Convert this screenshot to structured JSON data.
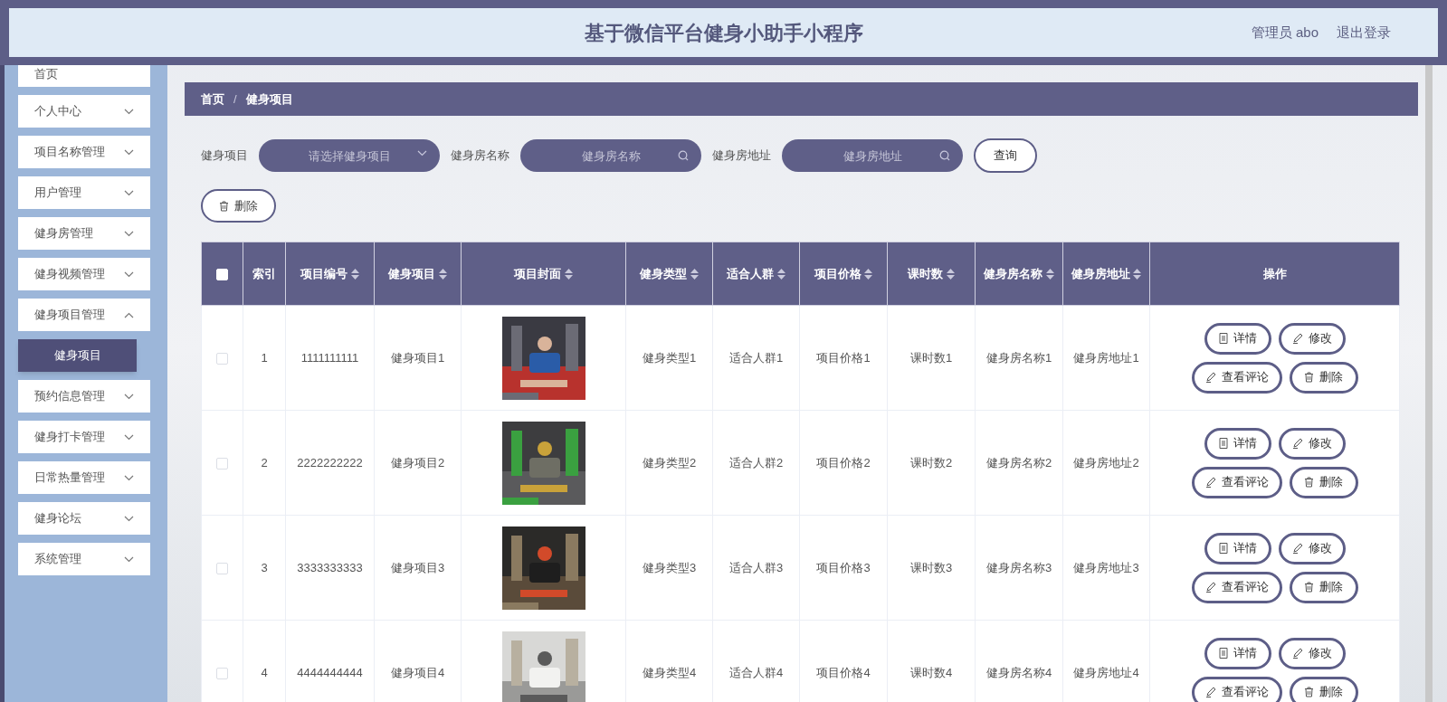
{
  "header": {
    "title": "基于微信平台健身小助手小程序",
    "user": "管理员 abo",
    "logout": "退出登录"
  },
  "sidebar": {
    "items": [
      {
        "label": "首页",
        "has_children": false
      },
      {
        "label": "个人中心",
        "has_children": true,
        "expanded": false
      },
      {
        "label": "项目名称管理",
        "has_children": true,
        "expanded": false
      },
      {
        "label": "用户管理",
        "has_children": true,
        "expanded": false
      },
      {
        "label": "健身房管理",
        "has_children": true,
        "expanded": false
      },
      {
        "label": "健身视频管理",
        "has_children": true,
        "expanded": false
      },
      {
        "label": "健身项目管理",
        "has_children": true,
        "expanded": true,
        "children": [
          {
            "label": "健身项目",
            "selected": true
          }
        ]
      },
      {
        "label": "预约信息管理",
        "has_children": true,
        "expanded": false
      },
      {
        "label": "健身打卡管理",
        "has_children": true,
        "expanded": false
      },
      {
        "label": "日常热量管理",
        "has_children": true,
        "expanded": false
      },
      {
        "label": "健身论坛",
        "has_children": true,
        "expanded": false
      },
      {
        "label": "系统管理",
        "has_children": true,
        "expanded": false
      }
    ]
  },
  "breadcrumb": [
    "首页",
    "健身项目"
  ],
  "breadcrumb_separator": "/",
  "filters": [
    {
      "label": "健身项目",
      "kind": "select",
      "placeholder": "请选择健身项目"
    },
    {
      "label": "健身房名称",
      "kind": "search",
      "placeholder": "健身房名称"
    },
    {
      "label": "健身房地址",
      "kind": "search",
      "placeholder": "健身房地址"
    }
  ],
  "query_button": "查询",
  "delete_button": "删除",
  "table": {
    "select_all": {
      "checked": false
    },
    "columns": [
      {
        "label": "索引",
        "sortable": false
      },
      {
        "label": "项目编号",
        "sortable": true
      },
      {
        "label": "健身项目",
        "sortable": true
      },
      {
        "label": "项目封面",
        "sortable": true
      },
      {
        "label": "健身类型",
        "sortable": true
      },
      {
        "label": "适合人群",
        "sortable": true
      },
      {
        "label": "项目价格",
        "sortable": true
      },
      {
        "label": "课时数",
        "sortable": true
      },
      {
        "label": "健身房名称",
        "sortable": true
      },
      {
        "label": "健身房地址",
        "sortable": true
      },
      {
        "label": "操作",
        "sortable": false
      }
    ],
    "rows": [
      {
        "checked": false,
        "cells": [
          "1",
          "1111111111",
          "健身项目1",
          {
            "kind": "picture"
          },
          "健身类型1",
          "适合人群1",
          "项目价格1",
          "课时数1",
          "健身房名称1",
          "健身房地址1"
        ],
        "actions": [
          "详情",
          "修改",
          "查看评论",
          "删除"
        ]
      },
      {
        "checked": false,
        "cells": [
          "2",
          "2222222222",
          "健身项目2",
          {
            "kind": "picture"
          },
          "健身类型2",
          "适合人群2",
          "项目价格2",
          "课时数2",
          "健身房名称2",
          "健身房地址2"
        ],
        "actions": [
          "详情",
          "修改",
          "查看评论",
          "删除"
        ]
      },
      {
        "checked": false,
        "cells": [
          "3",
          "3333333333",
          "健身项目3",
          {
            "kind": "picture"
          },
          "健身类型3",
          "适合人群3",
          "项目价格3",
          "课时数3",
          "健身房名称3",
          "健身房地址3"
        ],
        "actions": [
          "详情",
          "修改",
          "查看评论",
          "删除"
        ]
      },
      {
        "checked": false,
        "cells": [
          "4",
          "4444444444",
          "健身项目4",
          {
            "kind": "picture"
          },
          "健身类型4",
          "适合人群4",
          "项目价格4",
          "课时数4",
          "健身房名称4",
          "健身房地址4"
        ],
        "actions": [
          "详情",
          "修改",
          "查看评论",
          "删除"
        ]
      }
    ]
  }
}
